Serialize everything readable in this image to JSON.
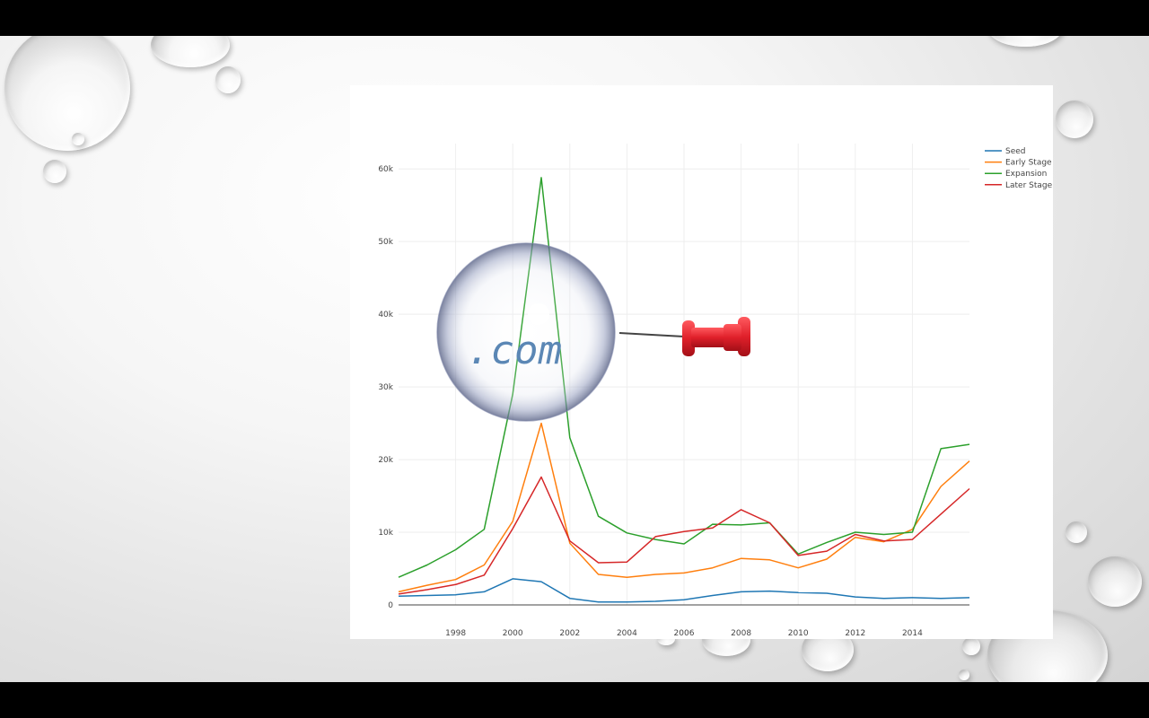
{
  "chart_data": {
    "type": "line",
    "title": "",
    "xlabel": "",
    "ylabel": "",
    "x": [
      1996,
      1997,
      1998,
      1999,
      2000,
      2001,
      2002,
      2003,
      2004,
      2005,
      2006,
      2007,
      2008,
      2009,
      2010,
      2011,
      2012,
      2013,
      2014,
      2015,
      2016
    ],
    "x_ticks": [
      "1998",
      "2000",
      "2002",
      "2004",
      "2006",
      "2008",
      "2010",
      "2012",
      "2014"
    ],
    "x_tick_values": [
      1998,
      2000,
      2002,
      2004,
      2006,
      2008,
      2010,
      2012,
      2014
    ],
    "y_ticks": [
      "0",
      "10k",
      "20k",
      "30k",
      "40k",
      "50k",
      "60k"
    ],
    "y_tick_values": [
      0,
      10000,
      20000,
      30000,
      40000,
      50000,
      60000
    ],
    "xlim": [
      1996,
      2016
    ],
    "ylim": [
      0,
      62000
    ],
    "grid": true,
    "legend_position": "top-right",
    "series": [
      {
        "name": "Seed",
        "color": "#1f77b4",
        "values": [
          1200,
          1300,
          1400,
          1800,
          3600,
          3200,
          900,
          400,
          400,
          500,
          700,
          1300,
          1800,
          1900,
          1700,
          1600,
          1100,
          900,
          1000,
          900,
          1000
        ]
      },
      {
        "name": "Early Stage",
        "color": "#ff7f0e",
        "values": [
          1800,
          2700,
          3500,
          5500,
          11500,
          25000,
          8500,
          4200,
          3800,
          4200,
          4400,
          5100,
          6400,
          6200,
          5100,
          6300,
          9300,
          8700,
          10400,
          16300,
          19800
        ]
      },
      {
        "name": "Expansion",
        "color": "#2ca02c",
        "values": [
          3800,
          5500,
          7600,
          10400,
          29000,
          58800,
          23000,
          12200,
          9900,
          9000,
          8400,
          11100,
          11000,
          11300,
          7000,
          8600,
          10000,
          9700,
          10000,
          21500,
          22100
        ]
      },
      {
        "name": "Later Stage",
        "color": "#d62728",
        "values": [
          1500,
          2100,
          2800,
          4100,
          10500,
          17600,
          8800,
          5800,
          5900,
          9400,
          10100,
          10600,
          13100,
          11300,
          6800,
          7400,
          9700,
          8800,
          9000,
          12500,
          16000
        ]
      }
    ]
  },
  "overlay": {
    "bubble_text": ".com",
    "bubble_color": "#5b87b5",
    "pin_color": "#e0202a",
    "pin_icon": "push-pin-icon"
  }
}
